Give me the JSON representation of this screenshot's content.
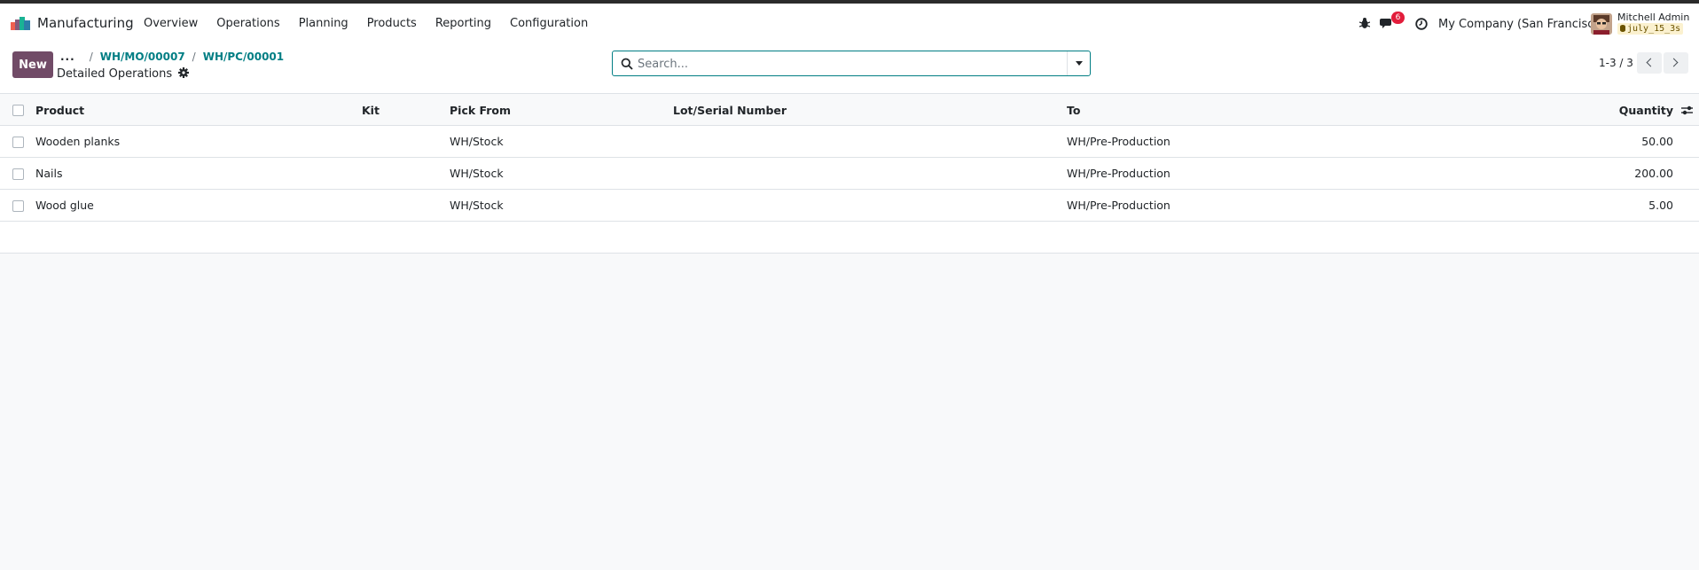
{
  "navbar": {
    "app_name": "Manufacturing",
    "menu": [
      "Overview",
      "Operations",
      "Planning",
      "Products",
      "Reporting",
      "Configuration"
    ],
    "chat_badge": "6",
    "company": "My Company (San Francisco)",
    "user_name": "Mitchell Admin",
    "database": "july_15_3s"
  },
  "control_panel": {
    "new_label": "New",
    "breadcrumb_dots": "...",
    "breadcrumb": [
      "WH/MO/00007",
      "WH/PC/00001"
    ],
    "page_title": "Detailed Operations",
    "search_placeholder": "Search...",
    "pager": "1-3 / 3"
  },
  "table": {
    "headers": {
      "product": "Product",
      "kit": "Kit",
      "pick_from": "Pick From",
      "lot": "Lot/Serial Number",
      "to": "To",
      "quantity": "Quantity"
    },
    "rows": [
      {
        "product": "Wooden planks",
        "kit": "",
        "pick_from": "WH/Stock",
        "lot": "",
        "to": "WH/Pre-Production",
        "quantity": "50.00"
      },
      {
        "product": "Nails",
        "kit": "",
        "pick_from": "WH/Stock",
        "lot": "",
        "to": "WH/Pre-Production",
        "quantity": "200.00"
      },
      {
        "product": "Wood glue",
        "kit": "",
        "pick_from": "WH/Stock",
        "lot": "",
        "to": "WH/Pre-Production",
        "quantity": "5.00"
      }
    ]
  },
  "colors": {
    "primary": "#714b67",
    "link": "#017e84",
    "badge": "#e21d3b"
  },
  "icons": [
    "manufacturing-logo",
    "bug-icon",
    "chat-icon",
    "clock-icon",
    "gear-icon",
    "search-icon",
    "caret-down-icon",
    "chevron-left-icon",
    "chevron-right-icon",
    "optional-columns-icon"
  ]
}
